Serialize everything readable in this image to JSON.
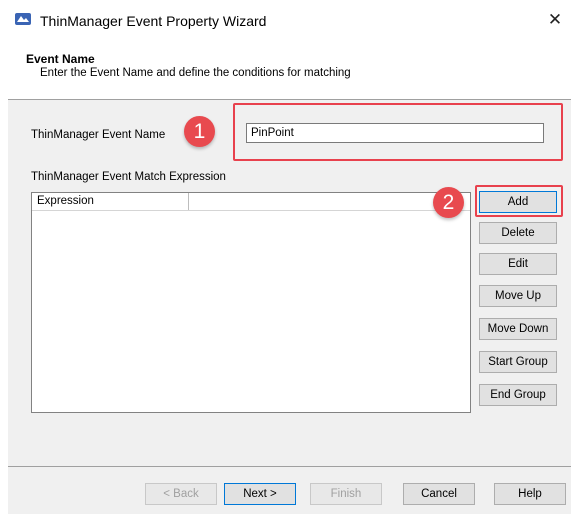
{
  "window": {
    "title": "ThinManager Event Property Wizard",
    "close_glyph": "✕"
  },
  "page": {
    "heading": "Event Name",
    "subheading": "Enter the Event Name and define the conditions for matching"
  },
  "form": {
    "event_name_label": "ThinManager Event Name",
    "event_name_value": "PinPoint",
    "match_expression_label": "ThinManager Event Match Expression",
    "columns": [
      "Expression",
      ""
    ]
  },
  "side_buttons": {
    "add": "Add",
    "delete": "Delete",
    "edit": "Edit",
    "move_up": "Move Up",
    "move_down": "Move Down",
    "start_group": "Start Group",
    "end_group": "End Group"
  },
  "footer_buttons": {
    "back": "< Back",
    "next": "Next >",
    "finish": "Finish",
    "cancel": "Cancel",
    "help": "Help"
  },
  "callouts": {
    "badge_1": "1",
    "badge_2": "2",
    "color": "#e8414d"
  },
  "icons": {
    "app": "thinmanager-app-icon",
    "close": "close-icon"
  }
}
